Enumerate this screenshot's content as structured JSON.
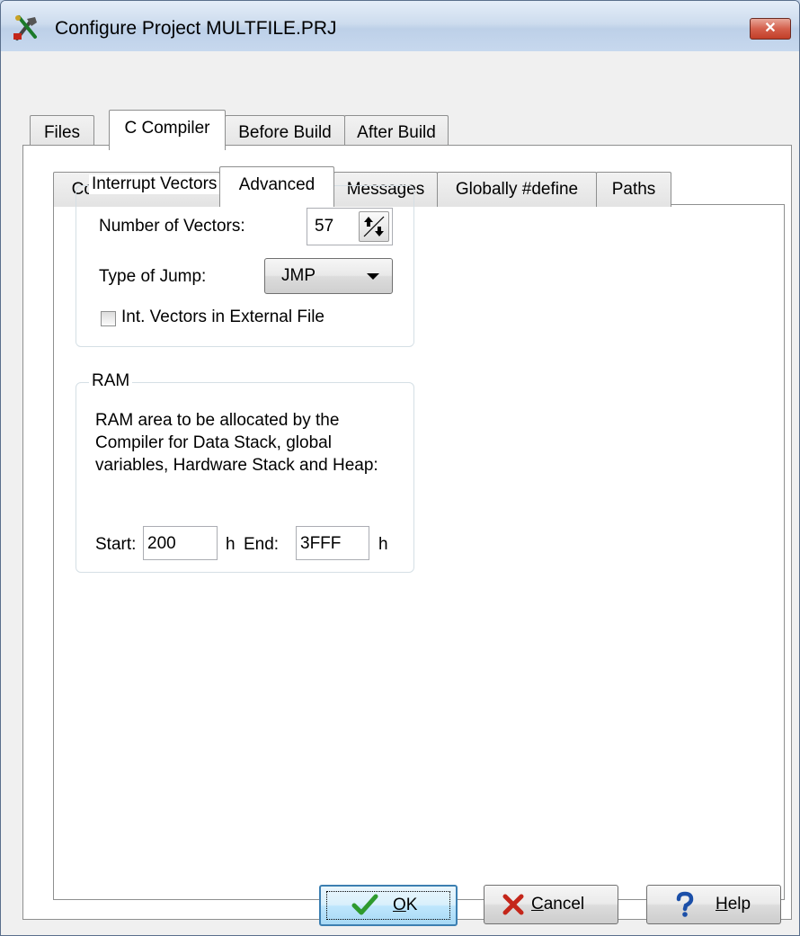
{
  "window": {
    "title": "Configure Project MULTFILE.PRJ",
    "close_glyph": "✕"
  },
  "top_tabs": [
    {
      "label": "Files"
    },
    {
      "label": "C Compiler",
      "active": true
    },
    {
      "label": "Before Build"
    },
    {
      "label": "After Build"
    }
  ],
  "sub_tabs": [
    {
      "label": "Code Generation"
    },
    {
      "label": "Advanced",
      "active": true
    },
    {
      "label": "Messages"
    },
    {
      "label": "Globally #define"
    },
    {
      "label": "Paths"
    }
  ],
  "interrupt_vectors": {
    "legend": "Interrupt Vectors Table",
    "num_vectors_label": "Number of Vectors:",
    "num_vectors_value": "57",
    "jump_type_label": "Type of Jump:",
    "jump_type_value": "JMP",
    "external_file_label": "Int. Vectors in External File",
    "external_file_checked": false
  },
  "ram": {
    "legend": "RAM",
    "description": "RAM area to be allocated by the Compiler for Data Stack, global variables, Hardware Stack and Heap:",
    "start_label": "Start:",
    "start_value": "200",
    "start_unit": "h",
    "end_label": "End:",
    "end_value": "3FFF",
    "end_unit": "h"
  },
  "buttons": {
    "ok": {
      "mnemonic": "O",
      "rest": "K",
      "icon": "check-icon"
    },
    "cancel": {
      "mnemonic": "C",
      "rest": "ancel",
      "icon": "x-icon"
    },
    "help": {
      "mnemonic": "H",
      "rest": "elp",
      "icon": "question-icon"
    }
  },
  "colors": {
    "ok_check": "#2e9a2e",
    "cancel_x": "#c4261a",
    "help_question": "#1b4fa8",
    "titlebar": "#cddcee",
    "close_button": "#c23e28"
  }
}
